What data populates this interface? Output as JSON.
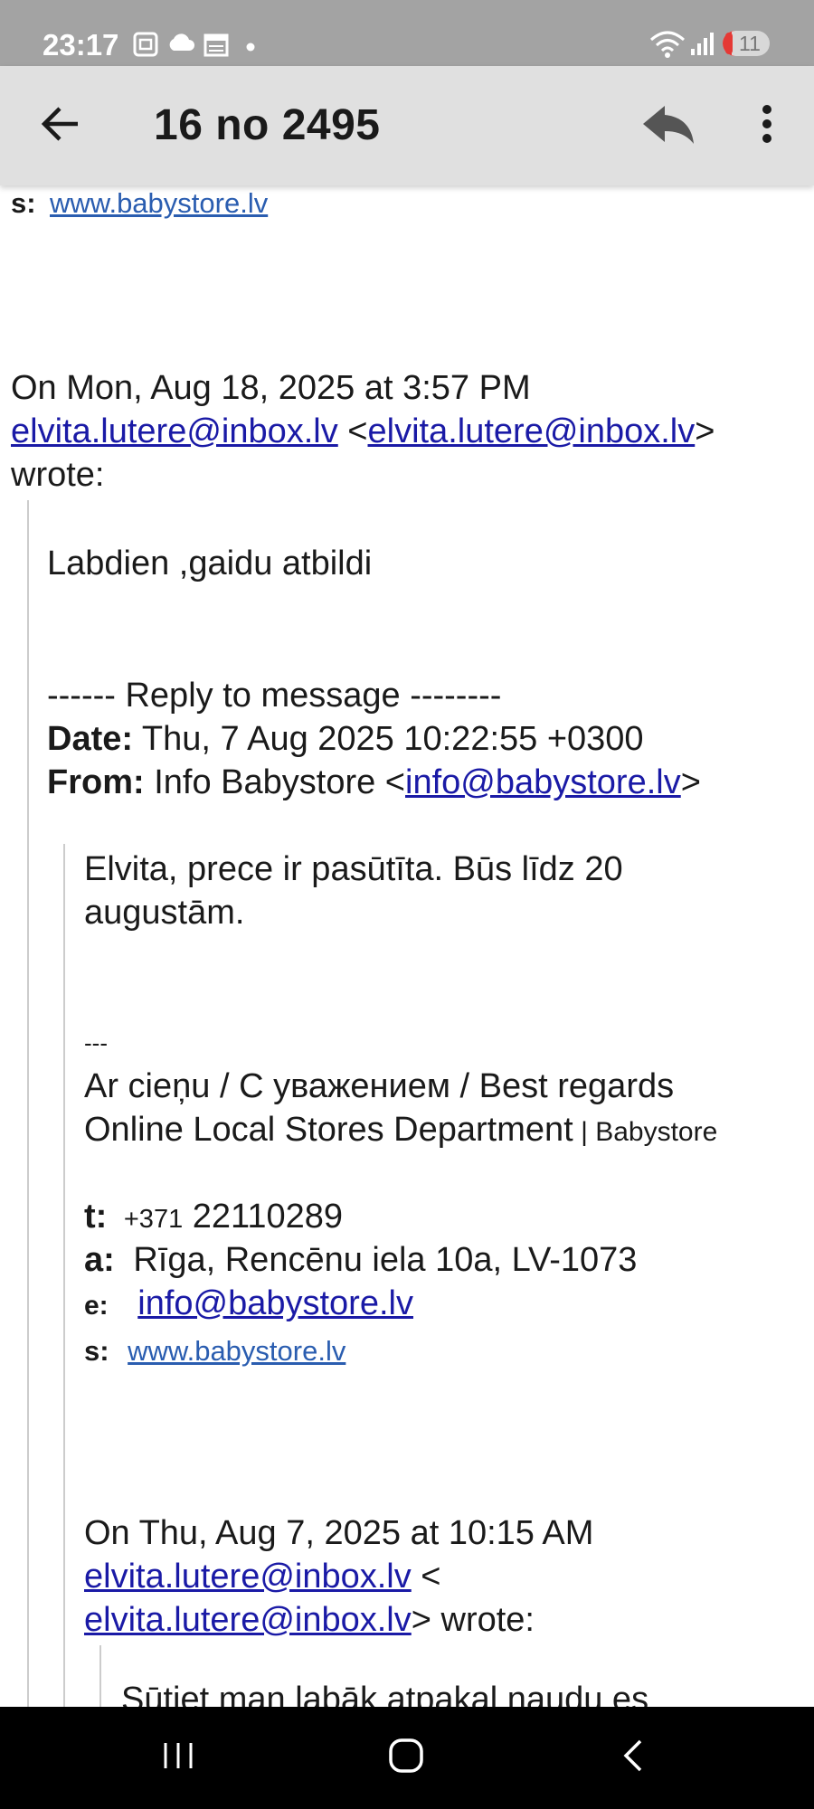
{
  "status_bar": {
    "time": "23:17",
    "battery": "11",
    "icons": [
      "screenshot-icon",
      "cloud-icon",
      "calendar-icon",
      "dot-icon",
      "wifi-icon",
      "signal-icon",
      "battery-icon"
    ]
  },
  "top_bar": {
    "title": "16 no 2495",
    "icons": [
      "back-arrow-icon",
      "reply-icon",
      "more-vert-icon"
    ]
  },
  "email": {
    "top_sig_label": "s:",
    "top_sig_link": "www.babystore.lv",
    "quote1_header": {
      "line1": "On Mon, Aug 18, 2025 at 3:57 PM",
      "email1": "elvita.lutere@inbox.lv",
      "lt": " <",
      "email2": "elvita.lutere@inbox.lv",
      "gt": ">",
      "wrote": "wrote:"
    },
    "quote1_body": "Labdien ,gaidu atbildi",
    "reply_header": {
      "separator": "------ Reply to message --------",
      "date_label": "Date:",
      "date_value": " Thu, 7 Aug 2025 10:22:55 +0300",
      "from_label": "From:",
      "from_name": " Info Babystore <",
      "from_email": "info@babystore.lv",
      "from_end": ">"
    },
    "quote2_body": {
      "line1": "Elvita, prece ir pasūtīta. Būs līdz 20",
      "line2": "augustām."
    },
    "signature": {
      "dashes": "---",
      "regards": "Ar cieņu / С уважением / Best regards",
      "dept": "Online Local Stores Department",
      "company": " | Babystore",
      "t_label": "t:",
      "t_prefix": "+371",
      "t_number": " 22110289",
      "a_label": "a:",
      "a_value": "Rīga, Rencēnu iela 10a, LV-1073",
      "e_label": "e:",
      "e_value": "info@babystore.lv",
      "s_label": "s:",
      "s_value": "www.babystore.lv"
    },
    "quote3_header": {
      "line1": "On Thu, Aug 7, 2025 at 10:15 AM",
      "email1": "elvita.lutere@inbox.lv",
      "lt": " <",
      "email2": "elvita.lutere@inbox.lv",
      "wrote": "> wrote:"
    },
    "quote3_body_partial": "Sūtiet man labāk atpakaļ naudu es"
  },
  "nav_bar": {
    "icons": [
      "recent-apps-icon",
      "home-icon",
      "back-icon"
    ]
  }
}
